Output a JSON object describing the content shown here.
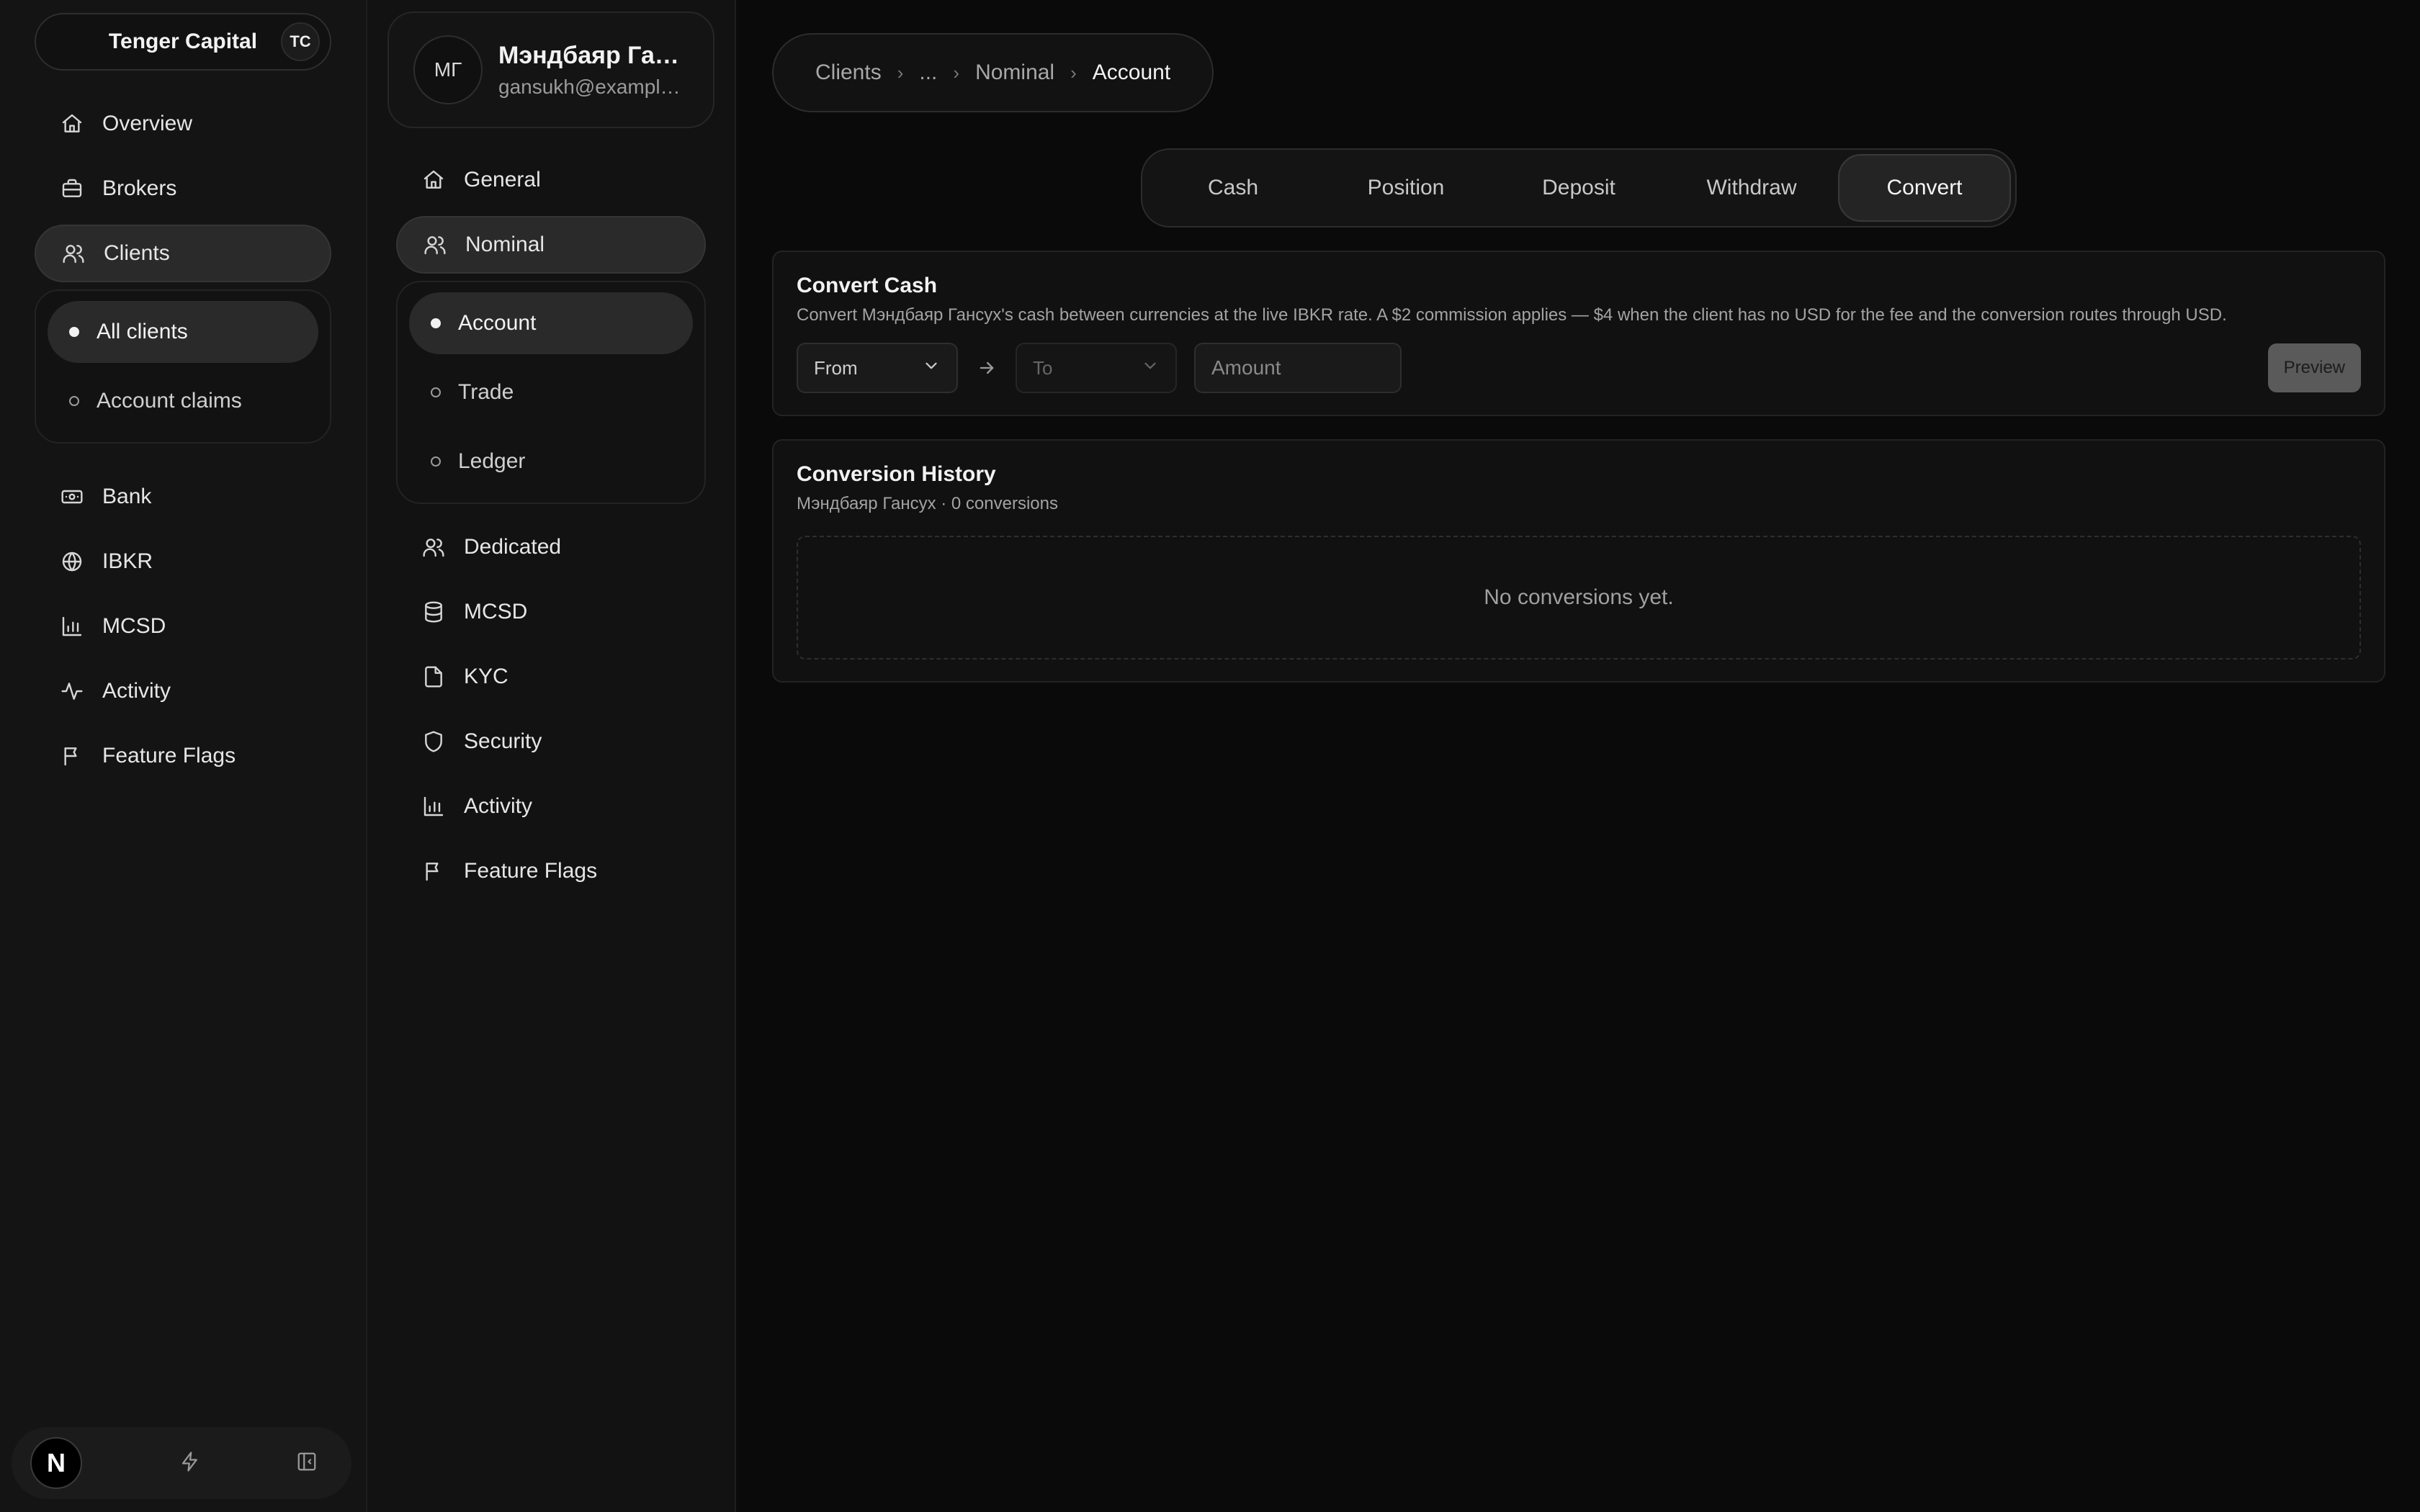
{
  "org": {
    "name": "Tenger Capital",
    "badge": "TC"
  },
  "sidebar": {
    "items": [
      {
        "label": "Overview",
        "icon": "home-icon"
      },
      {
        "label": "Brokers",
        "icon": "briefcase-icon"
      },
      {
        "label": "Clients",
        "icon": "users-icon",
        "active": true
      },
      {
        "label": "Bank",
        "icon": "banknote-icon"
      },
      {
        "label": "IBKR",
        "icon": "globe-icon"
      },
      {
        "label": "MCSD",
        "icon": "bar-chart-icon"
      },
      {
        "label": "Activity",
        "icon": "activity-icon"
      },
      {
        "label": "Feature Flags",
        "icon": "flag-icon"
      }
    ],
    "clients_sub": [
      {
        "label": "All clients",
        "active": true
      },
      {
        "label": "Account claims"
      }
    ]
  },
  "footer": {
    "logo": "N"
  },
  "client": {
    "initials": "МГ",
    "name": "Мэндбаяр Гансух",
    "email": "gansukh@example.com"
  },
  "client_nav": {
    "items": [
      {
        "label": "General",
        "icon": "home-icon"
      },
      {
        "label": "Nominal",
        "icon": "users-icon",
        "active": true
      },
      {
        "label": "Dedicated",
        "icon": "users-icon"
      },
      {
        "label": "MCSD",
        "icon": "database-icon"
      },
      {
        "label": "KYC",
        "icon": "file-icon"
      },
      {
        "label": "Security",
        "icon": "shield-icon"
      },
      {
        "label": "Activity",
        "icon": "bar-chart-icon"
      },
      {
        "label": "Feature Flags",
        "icon": "flag-icon"
      }
    ],
    "nominal_sub": [
      {
        "label": "Account",
        "active": true
      },
      {
        "label": "Trade"
      },
      {
        "label": "Ledger"
      }
    ]
  },
  "breadcrumb": {
    "items": [
      "Clients",
      "...",
      "Nominal",
      "Account"
    ]
  },
  "tabs": [
    {
      "label": "Cash"
    },
    {
      "label": "Position"
    },
    {
      "label": "Deposit"
    },
    {
      "label": "Withdraw"
    },
    {
      "label": "Convert",
      "active": true
    }
  ],
  "convert": {
    "title": "Convert Cash",
    "description": "Convert Мэндбаяр Гансух's cash between currencies at the live IBKR rate. A $2 commission applies — $4 when the client has no USD for the fee and the conversion routes through USD.",
    "from_label": "From",
    "to_label": "To",
    "amount_placeholder": "Amount",
    "preview_label": "Preview"
  },
  "history": {
    "title": "Conversion History",
    "subtitle": "Мэндбаяр Гансух · 0 conversions",
    "empty": "No conversions yet."
  }
}
